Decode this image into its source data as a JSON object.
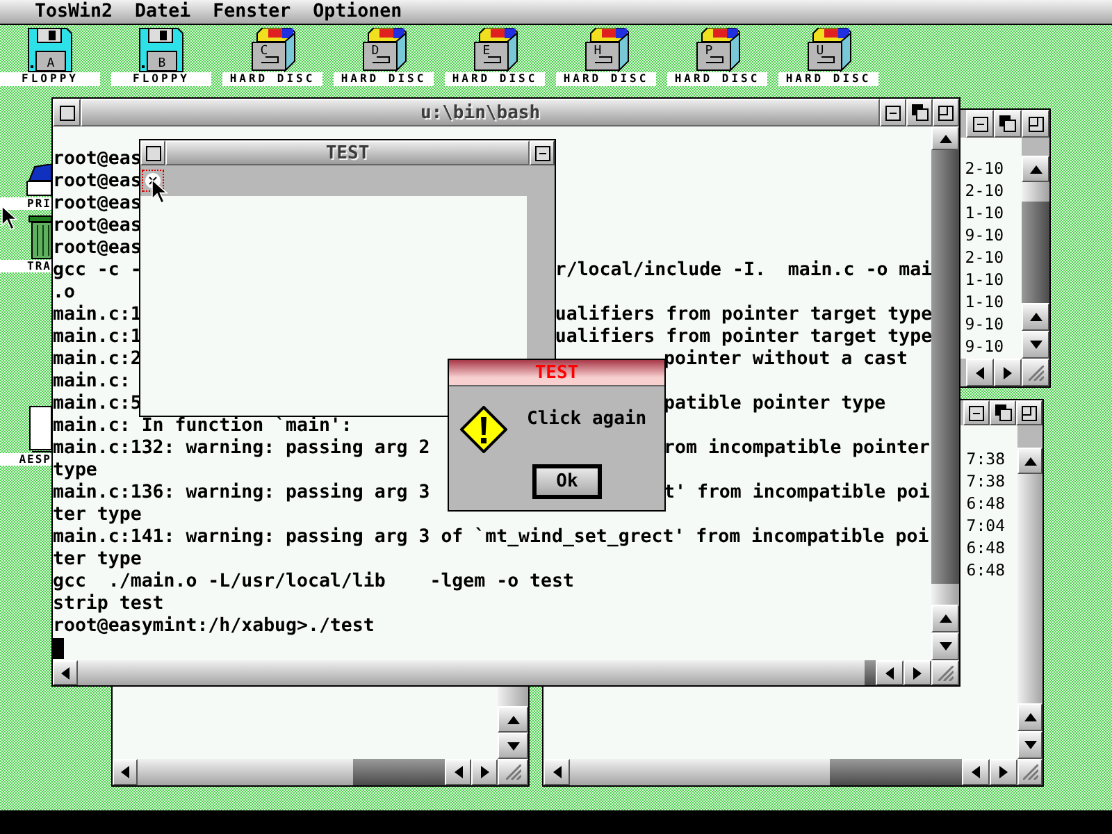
{
  "menu_bar": {
    "app_name": "TosWin2",
    "menus": [
      "Datei",
      "Fenster",
      "Optionen"
    ]
  },
  "drive_icons": [
    {
      "kind": "floppy",
      "letter": "A",
      "label": "FLOPPY"
    },
    {
      "kind": "floppy",
      "letter": "B",
      "label": "FLOPPY"
    },
    {
      "kind": "harddisc",
      "letter": "C",
      "label": "HARD DISC"
    },
    {
      "kind": "harddisc",
      "letter": "D",
      "label": "HARD DISC"
    },
    {
      "kind": "harddisc",
      "letter": "E",
      "label": "HARD DISC"
    },
    {
      "kind": "harddisc",
      "letter": "H",
      "label": "HARD DISC"
    },
    {
      "kind": "harddisc",
      "letter": "P",
      "label": "HARD DISC"
    },
    {
      "kind": "harddisc",
      "letter": "U",
      "label": "HARD DISC"
    }
  ],
  "side_icons": [
    {
      "kind": "printer",
      "label": "PRI"
    },
    {
      "kind": "trash",
      "label": "TRA"
    },
    {
      "kind": "file",
      "label": "AESP"
    }
  ],
  "dates_window": {
    "entries": [
      "2-10",
      "2-10",
      "1-10",
      "9-10",
      "2-10",
      "1-10",
      "1-10",
      "9-10",
      "9-10"
    ]
  },
  "times_window": {
    "entries": [
      "7:38",
      "7:38",
      "6:48",
      "7:04",
      "6:48",
      "6:48"
    ]
  },
  "terminal": {
    "title": "u:\\bin\\bash",
    "lines": [
      {
        "kind": "full",
        "left": "root@eas"
      },
      {
        "kind": "full",
        "left": "root@eas"
      },
      {
        "kind": "full",
        "left": "root@eas"
      },
      {
        "kind": "full",
        "left": "root@eas"
      },
      {
        "kind": "full",
        "left": "root@eas"
      },
      {
        "kind": "split_window",
        "left": "gcc -c -",
        "right": "r/local/include -I.  main.c -o mai"
      },
      {
        "kind": "full",
        "left": ".o"
      },
      {
        "kind": "split_window",
        "left": "main.c:1",
        "right": "ualifiers from pointer target type"
      },
      {
        "kind": "split_window",
        "left": "main.c:1",
        "right": "ualifiers from pointer target type"
      },
      {
        "kind": "split_dialog",
        "left": "main.c:2",
        "right": "pointer without a cast"
      },
      {
        "kind": "full",
        "left": "main.c:"
      },
      {
        "kind": "split_dialog",
        "left": "main.c:5",
        "right": "patible pointer type"
      },
      {
        "kind": "full",
        "left": "main.c: In function `main':"
      },
      {
        "kind": "split_dialog",
        "left": "main.c:132: warning: passing arg 2",
        "right": "rom incompatible pointer"
      },
      {
        "kind": "full",
        "left": "type"
      },
      {
        "kind": "split_dialog",
        "left": "main.c:136: warning: passing arg 3",
        "right": "t' from incompatible poi"
      },
      {
        "kind": "full",
        "left": "ter type"
      },
      {
        "kind": "full",
        "left": "main.c:141: warning: passing arg 3 of `mt_wind_set_grect' from incompatible poi"
      },
      {
        "kind": "full",
        "left": "ter type"
      },
      {
        "kind": "full",
        "left": "gcc  ./main.o -L/usr/local/lib    -lgem -o test"
      },
      {
        "kind": "full",
        "left": "strip test"
      },
      {
        "kind": "full",
        "left": "root@easymint:/h/xabug>./test"
      }
    ]
  },
  "test_window": {
    "title": "TEST"
  },
  "alert": {
    "title": "TEST",
    "message": "Click again",
    "button": "Ok"
  }
}
